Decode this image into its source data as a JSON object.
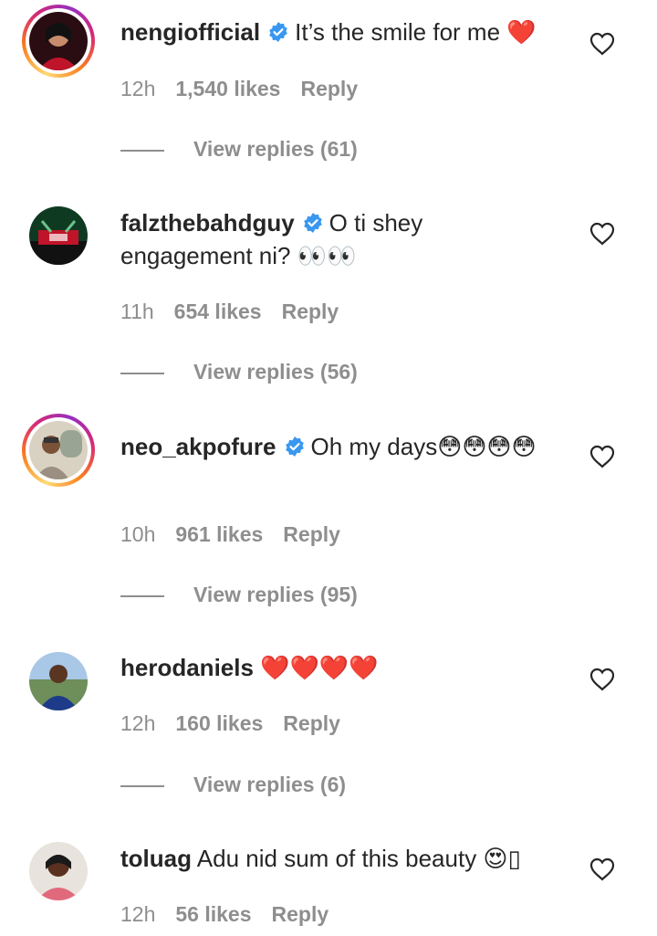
{
  "comments": [
    {
      "username": "nengiofficial",
      "verified": true,
      "text": "It’s the smile for me ❤️",
      "time": "12h",
      "likes": "1,540 likes",
      "reply": "Reply",
      "view_replies": "View replies (61)",
      "avatar_icon": "avatar-photo",
      "story_ring": true
    },
    {
      "username": "falzthebahdguy",
      "verified": true,
      "text": "O ti shey engagement ni? 👀👀",
      "time": "11h",
      "likes": "654 likes",
      "reply": "Reply",
      "view_replies": "View replies (56)",
      "avatar_icon": "avatar-photo",
      "story_ring": false
    },
    {
      "username": "neo_akpofure",
      "verified": true,
      "text": "Oh my days😳😳😳😳",
      "time": "10h",
      "likes": "961 likes",
      "reply": "Reply",
      "view_replies": "View replies (95)",
      "avatar_icon": "avatar-photo",
      "story_ring": true
    },
    {
      "username": "herodaniels",
      "verified": false,
      "text": "❤️❤️❤️❤️",
      "time": "12h",
      "likes": "160 likes",
      "reply": "Reply",
      "view_replies": "View replies (6)",
      "avatar_icon": "avatar-photo",
      "story_ring": false
    },
    {
      "username": "toluag",
      "verified": false,
      "text": "Adu nid sum of this beauty 😍▯",
      "time": "12h",
      "likes": "56 likes",
      "reply": "Reply",
      "avatar_icon": "avatar-photo",
      "story_ring": false
    }
  ],
  "colors": {
    "verified_blue": "#3897f0",
    "secondary_text": "#8e8e8e",
    "primary_text": "#262626",
    "heart_red": "#ed1c24"
  }
}
